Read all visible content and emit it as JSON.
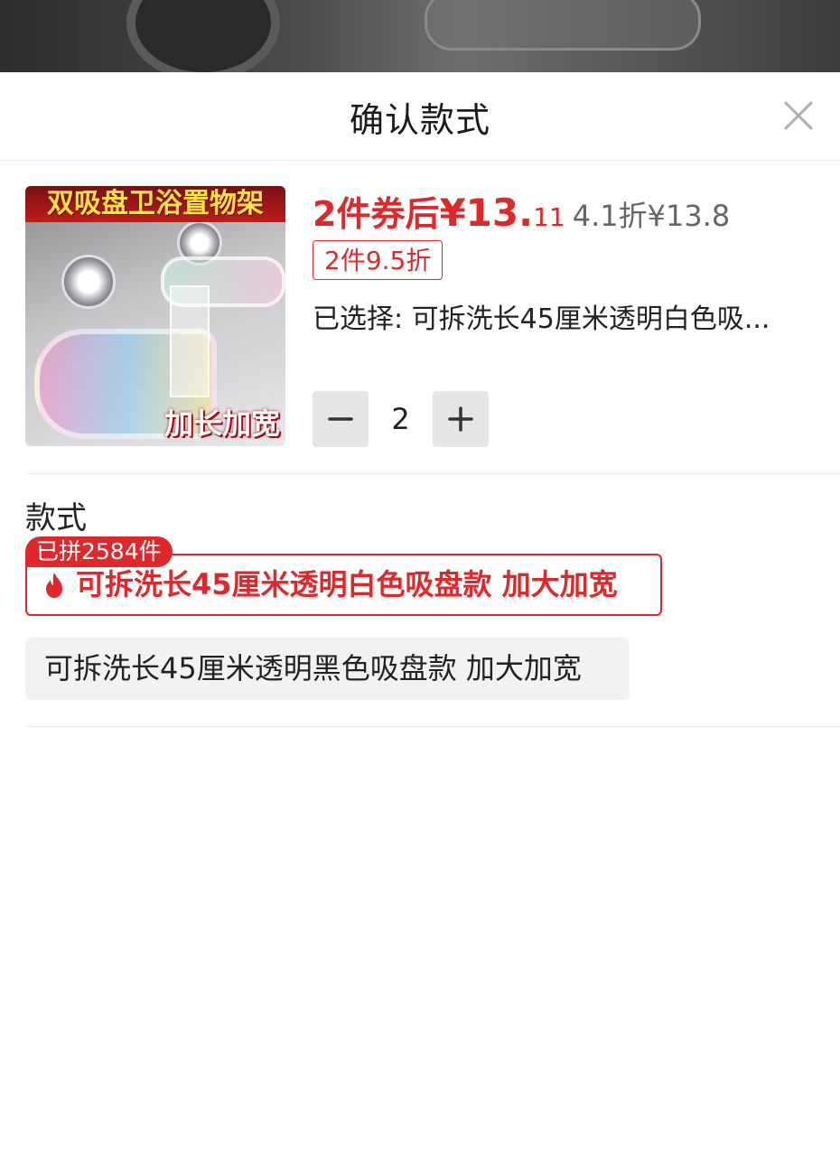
{
  "header": {
    "title": "确认款式"
  },
  "product": {
    "image_banner": "双吸盘卫浴置物架",
    "image_tag": "加长加宽",
    "price_prefix": "2件券后",
    "price_main": "¥13.",
    "price_decimal": "11",
    "original_price": "4.1折¥13.8",
    "discount_badge": "2件9.5折",
    "selected_text": "已选择: 可拆洗长45厘米透明白色吸..."
  },
  "quantity": {
    "value": "2"
  },
  "style_section": {
    "title": "款式",
    "sold_badge": "已拼2584件",
    "options": [
      {
        "label": "可拆洗长45厘米透明白色吸盘款 加大加宽",
        "selected": true
      },
      {
        "label": "可拆洗长45厘米透明黑色吸盘款 加大加宽",
        "selected": false
      }
    ]
  },
  "colors": {
    "accent": "#e0282a",
    "option_bg": "#f2f2f2",
    "stepper_bg": "#e6e6e6"
  },
  "icons": [
    "close-icon",
    "minus-icon",
    "plus-icon",
    "fire-icon"
  ]
}
